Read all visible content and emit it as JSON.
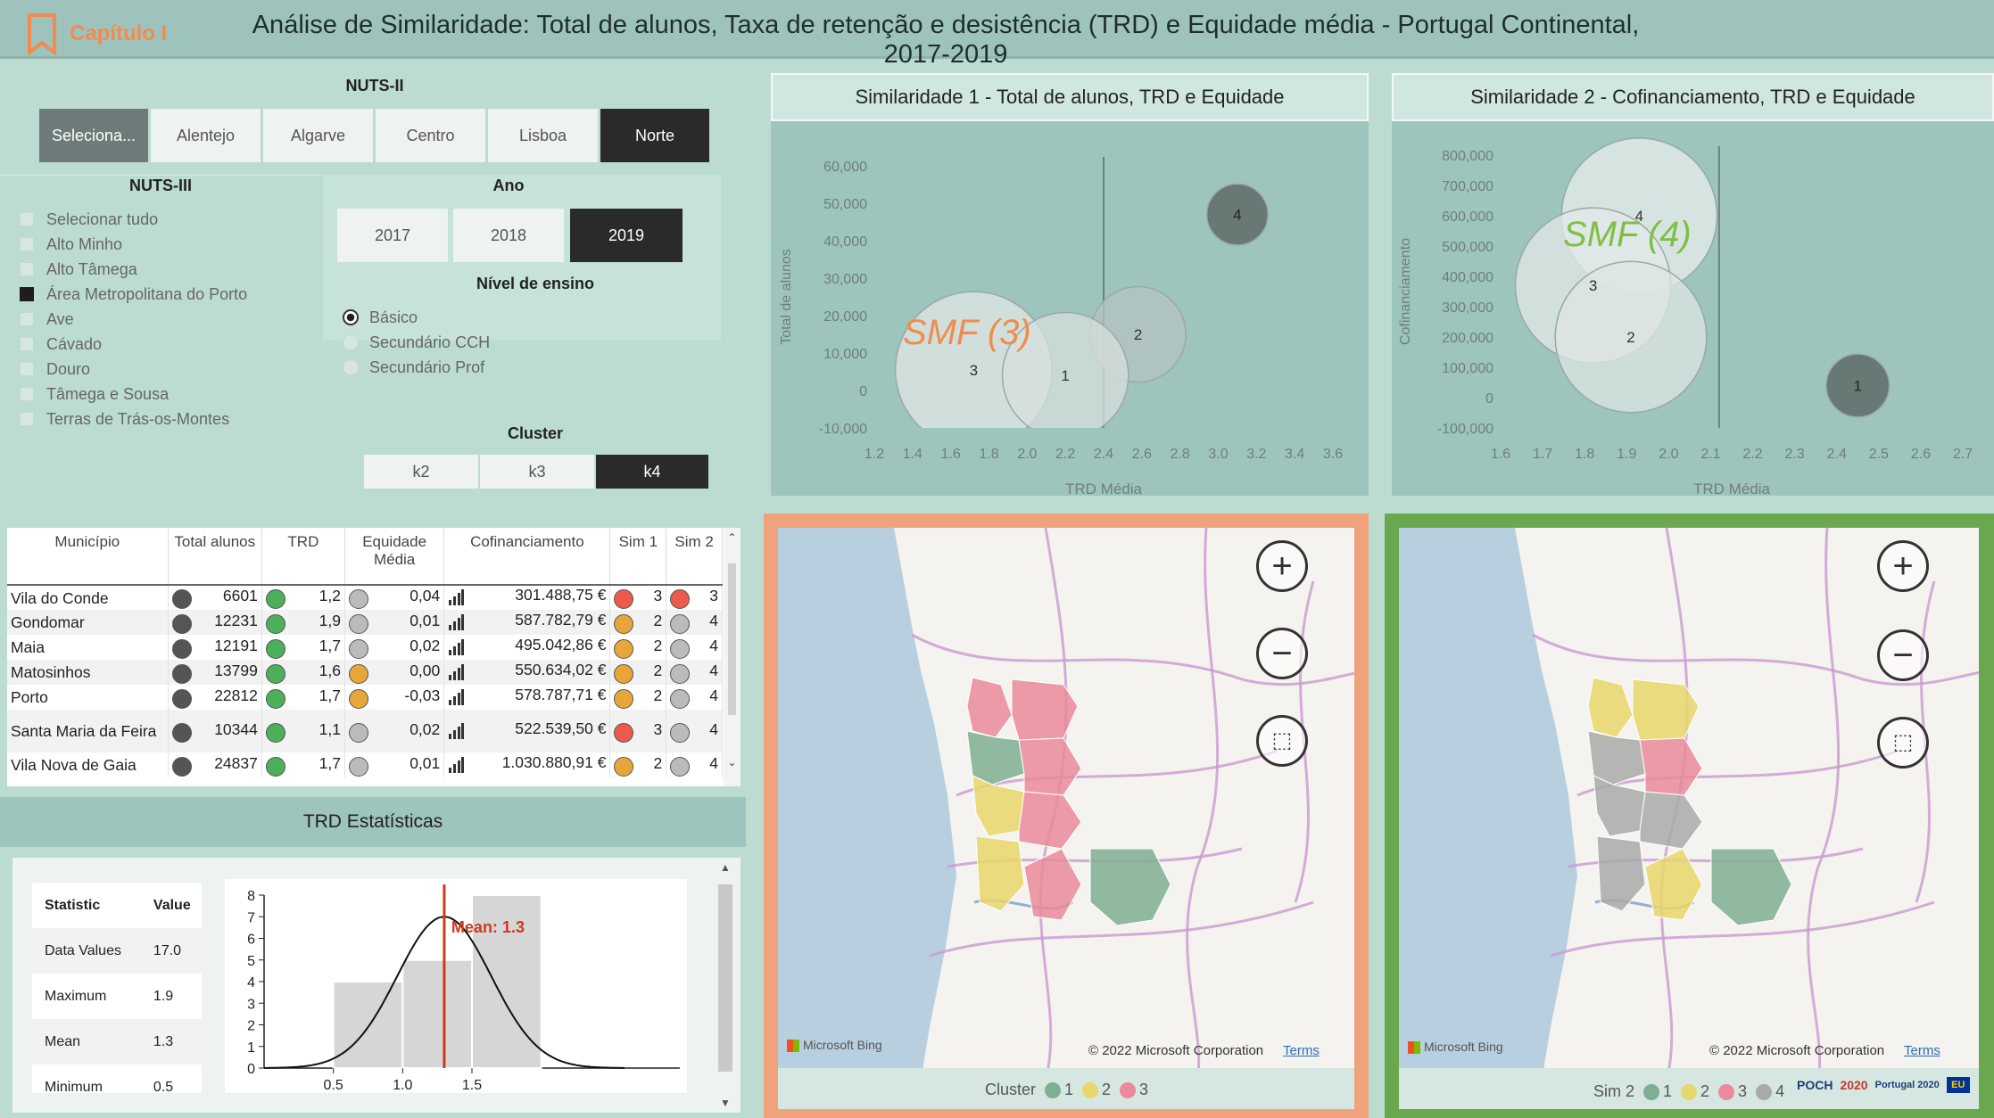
{
  "header": {
    "chapter": "Capítulo I",
    "title": "Análise de Similaridade: Total de alunos, Taxa de retenção e desistência (TRD) e Equidade média - Portugal Continental, 2017-2019"
  },
  "nuts2": {
    "title": "NUTS-II",
    "items": [
      "Seleciona...",
      "Alentejo",
      "Algarve",
      "Centro",
      "Lisboa",
      "Norte"
    ],
    "selected": "Norte"
  },
  "nuts3": {
    "title": "NUTS-III",
    "items": [
      "Selecionar tudo",
      "Alto Minho",
      "Alto Tâmega",
      "Área Metropolitana do Porto",
      "Ave",
      "Cávado",
      "Douro",
      "Tâmega e Sousa",
      "Terras de Trás-os-Montes"
    ],
    "checked": "Área Metropolitana do Porto"
  },
  "ano": {
    "title": "Ano",
    "items": [
      "2017",
      "2018",
      "2019"
    ],
    "selected": "2019"
  },
  "nivel": {
    "title": "Nível de ensino",
    "items": [
      "Básico",
      "Secundário CCH",
      "Secundário Prof"
    ],
    "selected": "Básico"
  },
  "cluster": {
    "title": "Cluster",
    "items": [
      "k2",
      "k3",
      "k4"
    ],
    "selected": "k4"
  },
  "sim1": {
    "title": "Similaridade 1 - Total de alunos, TRD e Equidade",
    "annotation": "SMF (3)",
    "xlabel": "TRD Média",
    "ylabel": "Total de alunos"
  },
  "sim2": {
    "title": "Similaridade 2 - Cofinanciamento, TRD e Equidade",
    "annotation": "SMF (4)",
    "xlabel": "TRD Média",
    "ylabel": "Cofinanciamento"
  },
  "chart_data": [
    {
      "type": "scatter",
      "title": "Similaridade 1 - Total de alunos, TRD e Equidade",
      "xlabel": "TRD Média",
      "ylabel": "Total de alunos",
      "xticks": [
        "1.2",
        "1.4",
        "1.6",
        "1.8",
        "2.0",
        "2.2",
        "2.4",
        "2.6",
        "2.8",
        "3.0",
        "3.2",
        "3.4",
        "3.6"
      ],
      "yticks": [
        "60,000",
        "50,000",
        "40,000",
        "30,000",
        "20,000",
        "10,000",
        "0",
        "-10,000"
      ],
      "xlim": [
        1.2,
        3.6
      ],
      "ylim": [
        -10000,
        60000
      ],
      "points": [
        {
          "label": "4",
          "x": 3.1,
          "y": 47000,
          "r": 0.16,
          "color": "#5f6b69"
        },
        {
          "label": "2",
          "x": 2.58,
          "y": 15000,
          "r": 0.25,
          "color": "#b6c4c2"
        },
        {
          "label": "3",
          "x": 1.72,
          "y": 5500,
          "r": 0.41,
          "color": "#e1e8e6"
        },
        {
          "label": "1",
          "x": 2.2,
          "y": 4000,
          "r": 0.33,
          "color": "#d7dfdd"
        }
      ]
    },
    {
      "type": "scatter",
      "title": "Similaridade 2 - Cofinanciamento, TRD e Equidade",
      "xlabel": "TRD Média",
      "ylabel": "Cofinanciamento",
      "xticks": [
        "1.6",
        "1.7",
        "1.8",
        "1.9",
        "2.0",
        "2.1",
        "2.2",
        "2.3",
        "2.4",
        "2.5",
        "2.6",
        "2.7"
      ],
      "yticks": [
        "800,000",
        "700,000",
        "600,000",
        "500,000",
        "400,000",
        "300,000",
        "200,000",
        "100,000",
        "0",
        "-100,000"
      ],
      "xlim": [
        1.6,
        2.7
      ],
      "ylim": [
        -100000,
        800000
      ],
      "points": [
        {
          "label": "4",
          "x": 1.93,
          "y": 600000,
          "r": 0.185,
          "color": "#e9efed"
        },
        {
          "label": "3",
          "x": 1.82,
          "y": 370000,
          "r": 0.185,
          "color": "#e3eae8"
        },
        {
          "label": "2",
          "x": 1.91,
          "y": 200000,
          "r": 0.18,
          "color": "#dde5e3"
        },
        {
          "label": "1",
          "x": 2.45,
          "y": 40000,
          "r": 0.075,
          "color": "#5f6b69"
        }
      ]
    },
    {
      "type": "table",
      "title": "Município",
      "columns": [
        "Município",
        "Total alunos",
        "TRD",
        "Equidade Média",
        "Cofinanciamento",
        "Sim 1",
        "Sim 2"
      ],
      "rows": [
        [
          "Vila do Conde",
          "6601",
          "1,2",
          "0,04",
          "301.488,75 €",
          "3",
          "3"
        ],
        [
          "Gondomar",
          "12231",
          "1,9",
          "0,01",
          "587.782,79 €",
          "2",
          "4"
        ],
        [
          "Maia",
          "12191",
          "1,7",
          "0,02",
          "495.042,86 €",
          "2",
          "4"
        ],
        [
          "Matosinhos",
          "13799",
          "1,6",
          "0,00",
          "550.634,02 €",
          "2",
          "4"
        ],
        [
          "Porto",
          "22812",
          "1,7",
          "-0,03",
          "578.787,71 €",
          "2",
          "4"
        ],
        [
          "Santa Maria da Feira",
          "10344",
          "1,1",
          "0,02",
          "522.539,50 €",
          "3",
          "4"
        ],
        [
          "Vila Nova de Gaia",
          "24837",
          "1,7",
          "0,01",
          "1.030.880,91 €",
          "2",
          "4"
        ]
      ]
    },
    {
      "type": "bar",
      "title": "TRD Estatísticas",
      "categories": [
        "0.5-1.0",
        "1.0-1.5",
        "1.5-2.0"
      ],
      "values": [
        4,
        5,
        8
      ],
      "yticks": [
        "0",
        "1",
        "2",
        "3",
        "4",
        "5",
        "6",
        "7",
        "8"
      ],
      "xticks": [
        "0.5",
        "1.0",
        "1.5"
      ],
      "mean": 1.3,
      "mean_label": "Mean: 1.3"
    }
  ],
  "table": {
    "headers": [
      "Município",
      "Total alunos",
      "TRD",
      "Equidade Média",
      "Cofinanciamento",
      "Sim 1",
      "Sim 2"
    ],
    "rows": [
      {
        "m": "Vila do Conde",
        "t": "6601",
        "trd": "1,2",
        "eq": "0,04",
        "cof": "301.488,75 €",
        "s1": "3",
        "s2": "3",
        "s1c": "#ea5b4e",
        "s2c": "#ea5b4e",
        "eqc": "#bbbbbb"
      },
      {
        "m": "Gondomar",
        "t": "12231",
        "trd": "1,9",
        "eq": "0,01",
        "cof": "587.782,79 €",
        "s1": "2",
        "s2": "4",
        "s1c": "#e6a63a",
        "s2c": "#bbbbbb",
        "eqc": "#bbbbbb"
      },
      {
        "m": "Maia",
        "t": "12191",
        "trd": "1,7",
        "eq": "0,02",
        "cof": "495.042,86 €",
        "s1": "2",
        "s2": "4",
        "s1c": "#e6a63a",
        "s2c": "#bbbbbb",
        "eqc": "#bbbbbb"
      },
      {
        "m": "Matosinhos",
        "t": "13799",
        "trd": "1,6",
        "eq": "0,00",
        "cof": "550.634,02 €",
        "s1": "2",
        "s2": "4",
        "s1c": "#e6a63a",
        "s2c": "#bbbbbb",
        "eqc": "#e6a63a"
      },
      {
        "m": "Porto",
        "t": "22812",
        "trd": "1,7",
        "eq": "-0,03",
        "cof": "578.787,71 €",
        "s1": "2",
        "s2": "4",
        "s1c": "#e6a63a",
        "s2c": "#bbbbbb",
        "eqc": "#e6a63a"
      },
      {
        "m": "Santa Maria da Feira",
        "t": "10344",
        "trd": "1,1",
        "eq": "0,02",
        "cof": "522.539,50 €",
        "s1": "3",
        "s2": "4",
        "s1c": "#ea5b4e",
        "s2c": "#bbbbbb",
        "eqc": "#bbbbbb"
      },
      {
        "m": "Vila Nova de Gaia",
        "t": "24837",
        "trd": "1,7",
        "eq": "0,01",
        "cof": "1.030.880,91 €",
        "s1": "2",
        "s2": "4",
        "s1c": "#e6a63a",
        "s2c": "#bbbbbb",
        "eqc": "#bbbbbb"
      }
    ]
  },
  "stats": {
    "title": "TRD Estatísticas",
    "head": [
      "Statistic",
      "Value"
    ],
    "rows": [
      [
        "Data Values",
        "17.0"
      ],
      [
        "Maximum",
        "1.9"
      ],
      [
        "Mean",
        "1.3"
      ],
      [
        "Minimum",
        "0.5"
      ]
    ]
  },
  "map1": {
    "bing": "Microsoft Bing",
    "copyright": "© 2022 Microsoft Corporation",
    "terms": "Terms",
    "legend_title": "Cluster",
    "legend": [
      {
        "label": "1",
        "color": "#7fae92"
      },
      {
        "label": "2",
        "color": "#e8d76a"
      },
      {
        "label": "3",
        "color": "#ea8a9a"
      }
    ]
  },
  "map2": {
    "bing": "Microsoft Bing",
    "copyright": "© 2022 Microsoft Corporation",
    "terms": "Terms",
    "legend_title": "Sim 2",
    "legend": [
      {
        "label": "1",
        "color": "#7fae92"
      },
      {
        "label": "2",
        "color": "#e8d76a"
      },
      {
        "label": "3",
        "color": "#ea8a9a"
      },
      {
        "label": "4",
        "color": "#a9a9a9"
      }
    ],
    "footer_logos": [
      "POCH",
      "2020",
      "Portugal 2020",
      "EU"
    ]
  },
  "colors": {
    "orange": "#f0a27d",
    "green": "#6aa84f",
    "smf1": "#f28b4e",
    "smf2": "#7fbf45",
    "mean": "#cc3a1e"
  }
}
